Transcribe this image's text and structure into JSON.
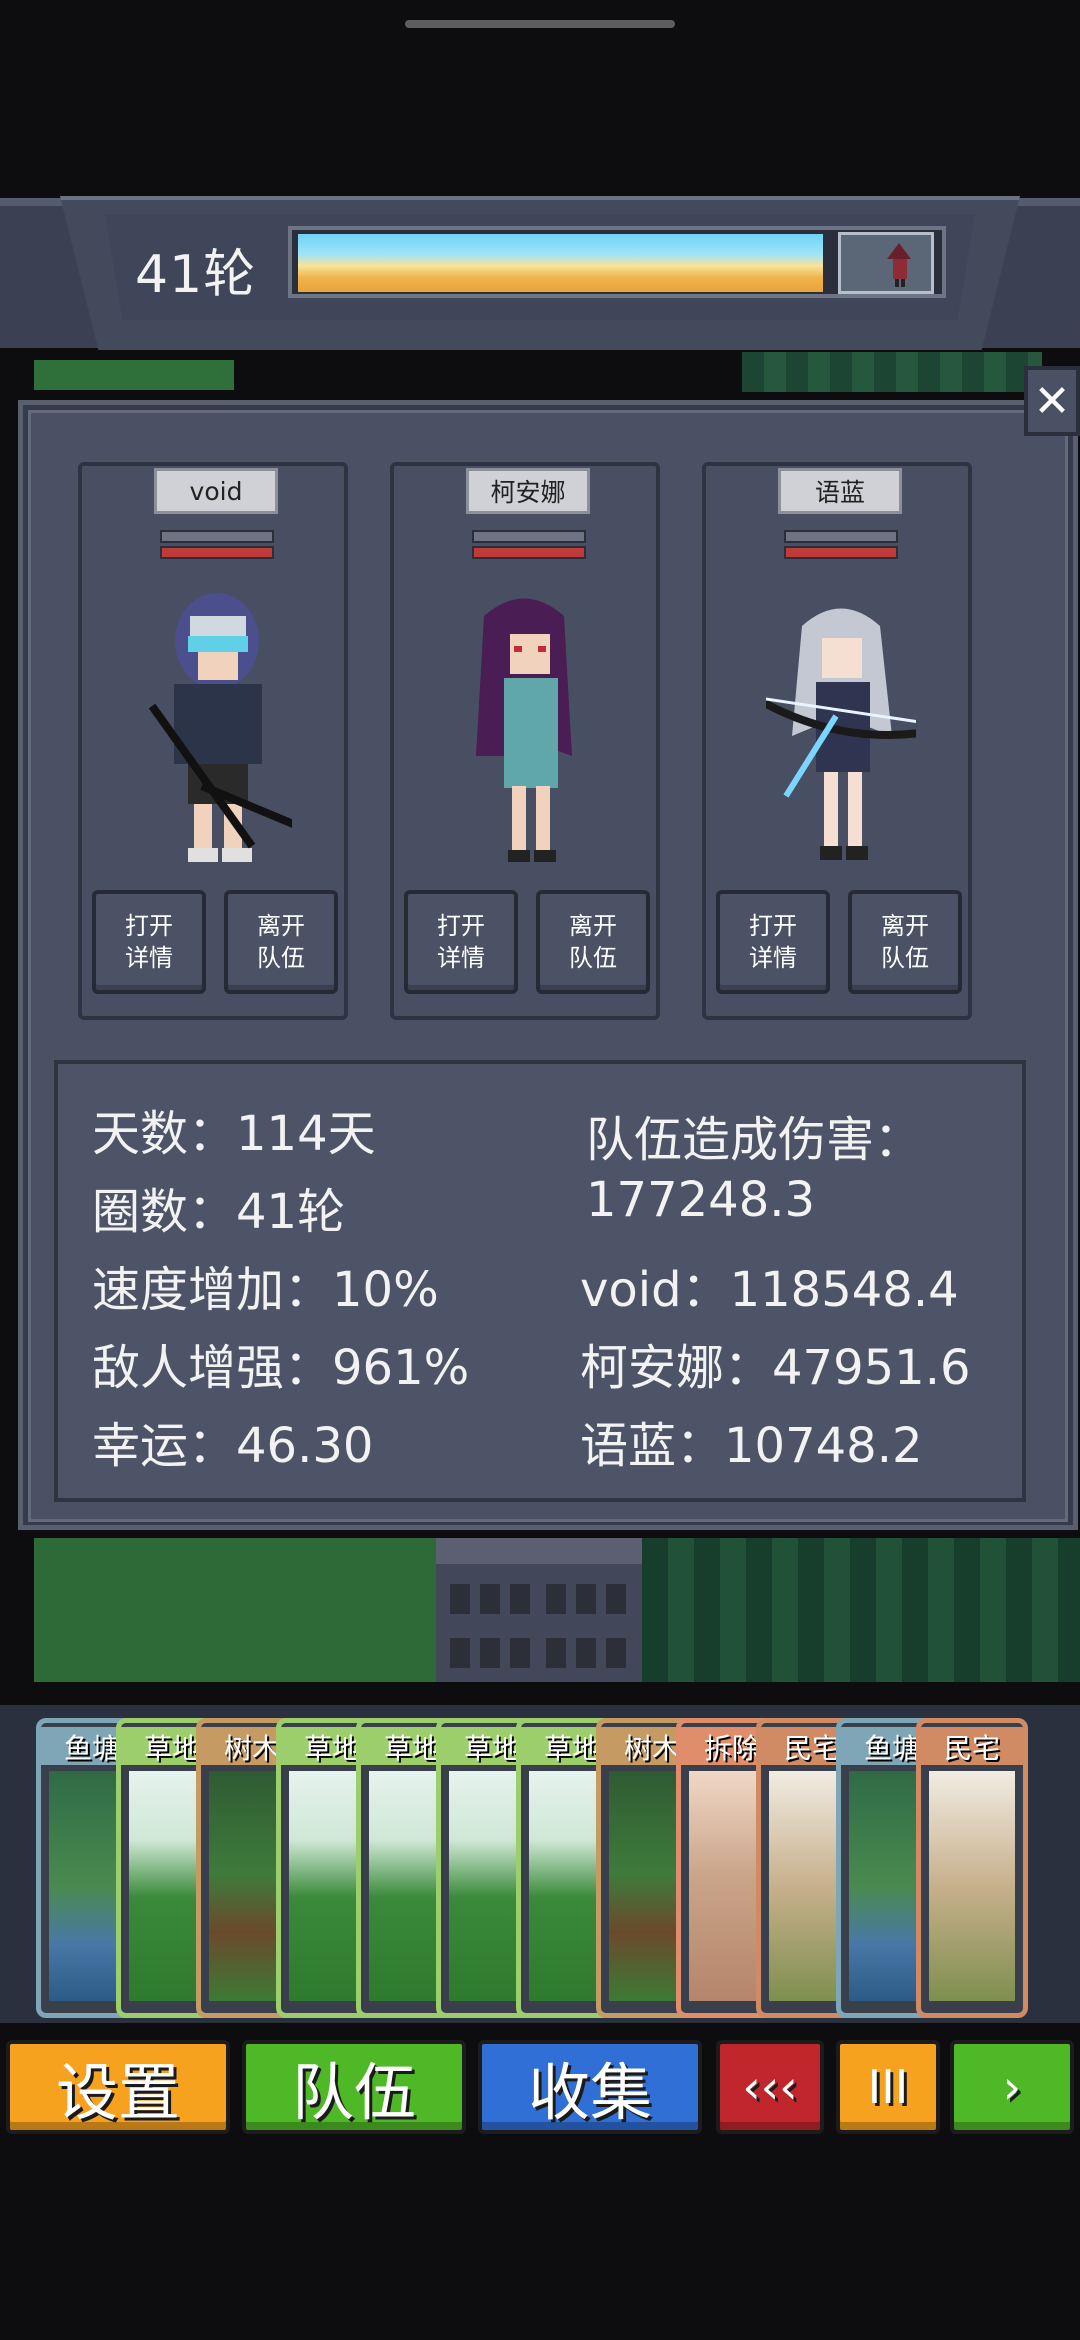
{
  "header": {
    "round_label": "41轮",
    "progress_fraction": 0.82
  },
  "panel": {
    "close_label": "✕",
    "characters": [
      {
        "name": "void",
        "open_label": "打开\n详情",
        "leave_label": "离开\n队伍"
      },
      {
        "name": "柯安娜",
        "open_label": "打开\n详情",
        "leave_label": "离开\n队伍"
      },
      {
        "name": "语蓝",
        "open_label": "打开\n详情",
        "leave_label": "离开\n队伍"
      }
    ],
    "stats": {
      "days": "天数：114天",
      "laps": "圈数：41轮",
      "speed": "速度增加：10%",
      "enemy": "敌人增强：961%",
      "luck": "幸运：46.30",
      "team_damage_label": "队伍造成伤害：",
      "team_damage_value": "177248.3",
      "void_damage": "void：118548.4",
      "keanna_damage": "柯安娜：47951.6",
      "yulan_damage": "语蓝：10748.2"
    }
  },
  "cards": [
    {
      "label": "鱼塘",
      "type": "pond"
    },
    {
      "label": "草地",
      "type": "grass"
    },
    {
      "label": "树木",
      "type": "tree"
    },
    {
      "label": "草地",
      "type": "grass"
    },
    {
      "label": "草地",
      "type": "grass"
    },
    {
      "label": "草地",
      "type": "grass"
    },
    {
      "label": "草地",
      "type": "grass"
    },
    {
      "label": "树木",
      "type": "tree"
    },
    {
      "label": "拆除",
      "type": "demolish"
    },
    {
      "label": "民宅",
      "type": "house"
    },
    {
      "label": "鱼塘",
      "type": "pond"
    },
    {
      "label": "民宅",
      "type": "house"
    }
  ],
  "buttons": {
    "settings": "设置",
    "team": "队伍",
    "collect": "收集",
    "rewind": "‹‹‹",
    "pause": "III",
    "next": "›"
  },
  "colors": {
    "settings": "#f7a21e",
    "team": "#4fb827",
    "collect": "#2f6fd6",
    "rewind": "#c0262b",
    "pause": "#f7a21e",
    "next": "#4fb827"
  }
}
